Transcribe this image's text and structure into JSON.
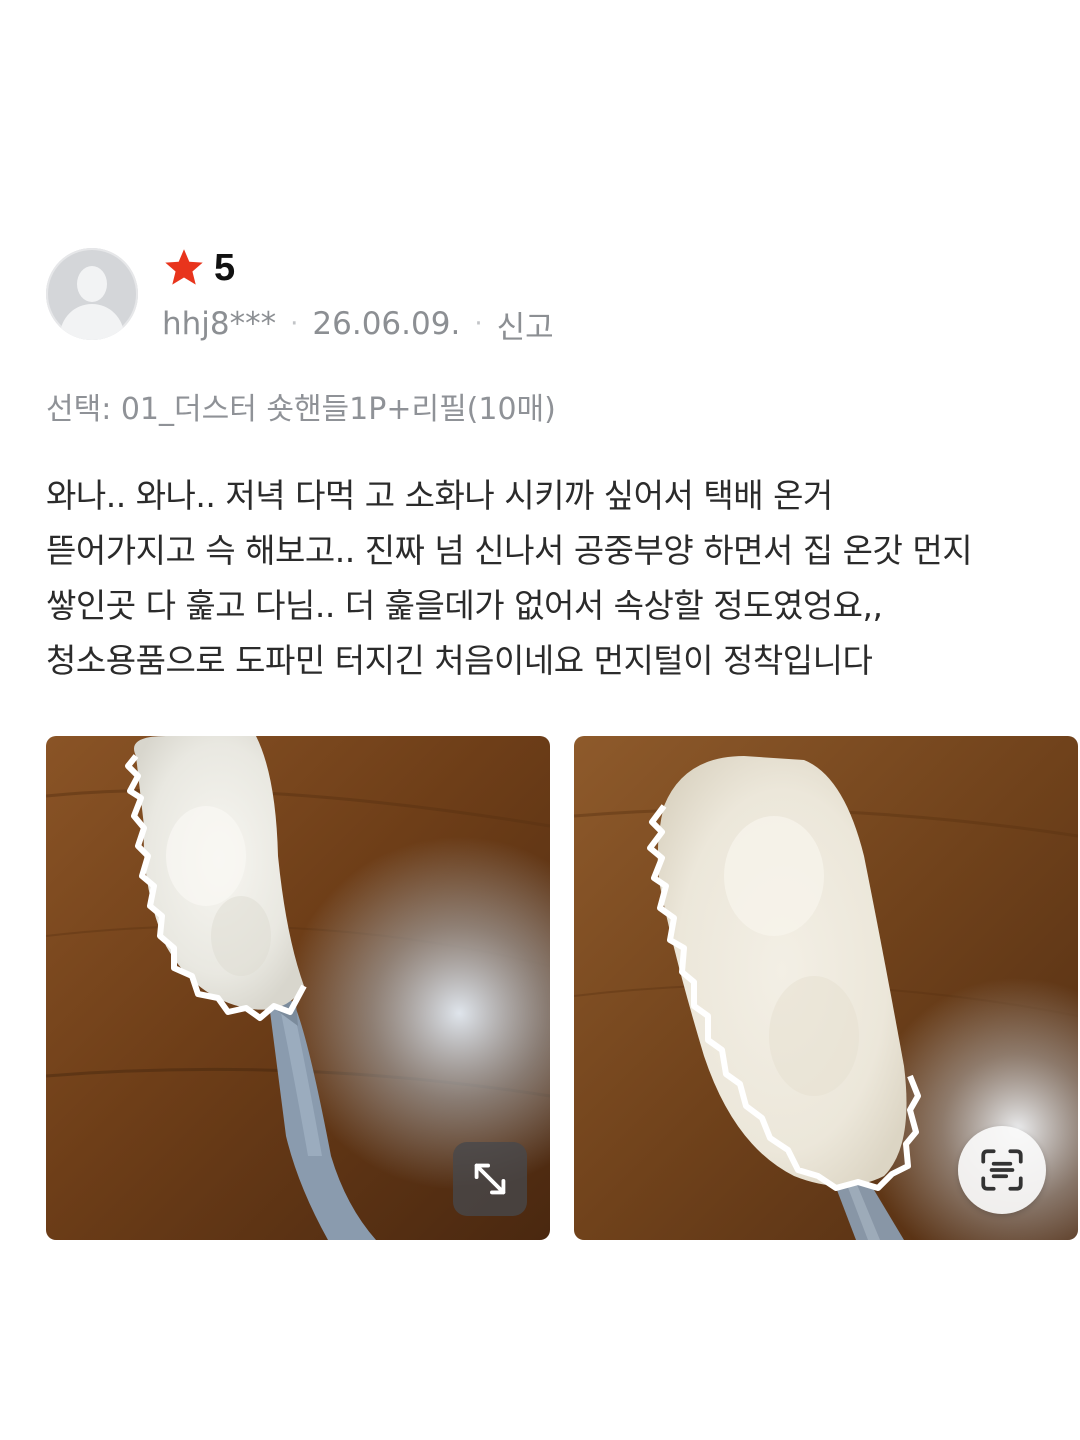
{
  "review": {
    "rating": "5",
    "star_color": "#e8341c",
    "author": "hhj8***",
    "date": "26.06.09.",
    "report_label": "신고",
    "option": "선택: 01_더스터 숏핸들1P+리필(10매)",
    "content": "와나.. 와나.. 저녁 다먹 고 소화나 시키까 싶어서 택배 온거\n뜯어가지고 슥 해보고.. 진짜 넘 신나서 공중부양 하면서 집 온갓 먼지\n쌓인곳 다 훑고 다님.. 더 훑을데가 없어서 속상할 정도였엉요,,\n청소용품으로 도파민 터지긴 처음이네요 먼지털이 정착입니다"
  },
  "photos": [
    {
      "subject": "white microfiber duster with gray handle on wooden table",
      "action_icon": "expand-icon"
    },
    {
      "subject": "white microfiber duster head close-up on wooden table",
      "action_icon": "text-scan-icon"
    }
  ],
  "colors": {
    "text": "#2b2b2b",
    "meta": "#8c8f93",
    "background": "#ffffff"
  }
}
